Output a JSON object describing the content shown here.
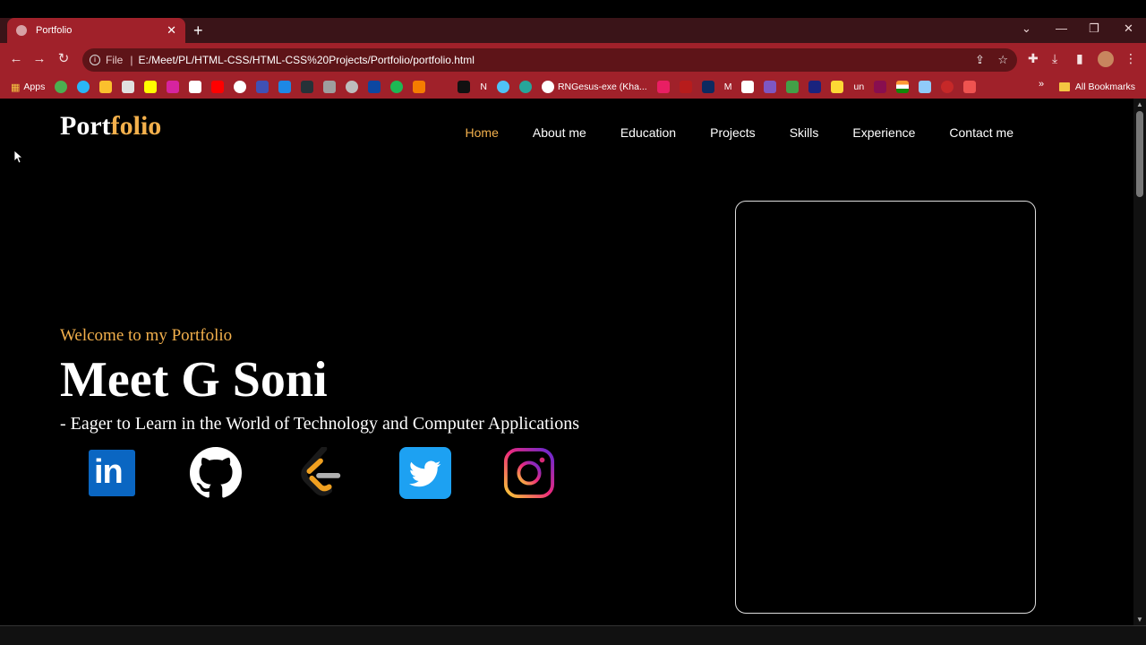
{
  "browser": {
    "tab_title": "Portfolio",
    "tab_close": "✕",
    "new_tab": "+",
    "url_scheme": "File",
    "url": "E:/Meet/PL/HTML-CSS/HTML-CSS%20Projects/Portfolio/portfolio.html",
    "bookmarks_apps": "Apps",
    "bookmark_rngesus": "RNGesus-exe (Kha...",
    "bookmark_n": "N",
    "bookmark_m": "M",
    "bookmark_un": "un",
    "bookmark_more": "»",
    "all_bookmarks": "All Bookmarks"
  },
  "site": {
    "logo_main": "Port",
    "logo_accent": "folio",
    "nav": [
      "Home",
      "About me",
      "Education",
      "Projects",
      "Skills",
      "Experience",
      "Contact me"
    ],
    "active_nav": "Home",
    "welcome": "Welcome to my Portfolio",
    "name": "Meet G Soni",
    "tagline": "- Eager to Learn in the World of Technology and Computer Applications",
    "linkedin_text": "in"
  },
  "colors": {
    "accent": "#f3b04c",
    "browser_red": "#a0212a",
    "linkedin": "#0a66c2",
    "twitter": "#1da1f2"
  }
}
